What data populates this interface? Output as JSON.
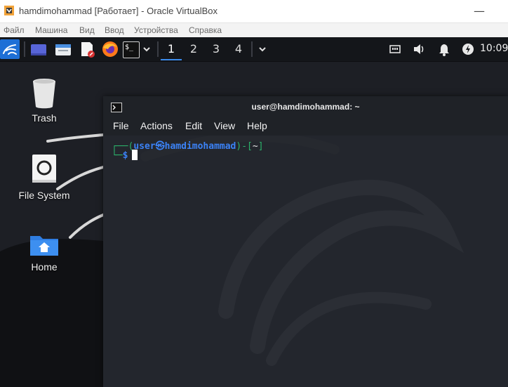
{
  "host": {
    "title": "hamdimohammad [Работает] - Oracle VirtualBox",
    "minimize_glyph": "—",
    "menu": [
      "Файл",
      "Машина",
      "Вид",
      "Ввод",
      "Устройства",
      "Справка"
    ]
  },
  "panel": {
    "launchers": [
      "kali-menu-icon",
      "desktop-icon",
      "file-manager-icon",
      "text-editor-icon",
      "firefox-icon",
      "terminal-icon"
    ],
    "terminal_prompt_glyph": "$_",
    "workspaces": [
      "1",
      "2",
      "3",
      "4"
    ],
    "active_workspace": "1",
    "tray": [
      "network-icon",
      "volume-icon",
      "notification-bell-icon",
      "power-icon"
    ],
    "clock": "10:09"
  },
  "desktop": {
    "icons": [
      {
        "label": "Trash",
        "icon": "trash-icon"
      },
      {
        "label": "File System",
        "icon": "drive-icon"
      },
      {
        "label": "Home",
        "icon": "home-folder-icon"
      }
    ]
  },
  "terminal": {
    "title": "user@hamdimohammad: ~",
    "menu": [
      "File",
      "Actions",
      "Edit",
      "View",
      "Help"
    ],
    "prompt": {
      "corner_top": "┌──(",
      "user": "user",
      "at": "㉿",
      "host": "hamdimohammad",
      "mid": ")-[",
      "path": "~",
      "close": "]",
      "corner_bottom": "└─",
      "symbol": "$"
    }
  },
  "colors": {
    "panel_bg": "#14161a",
    "accent": "#3b8beb",
    "prompt_green": "#2bb36b",
    "prompt_blue": "#3b82f6"
  }
}
